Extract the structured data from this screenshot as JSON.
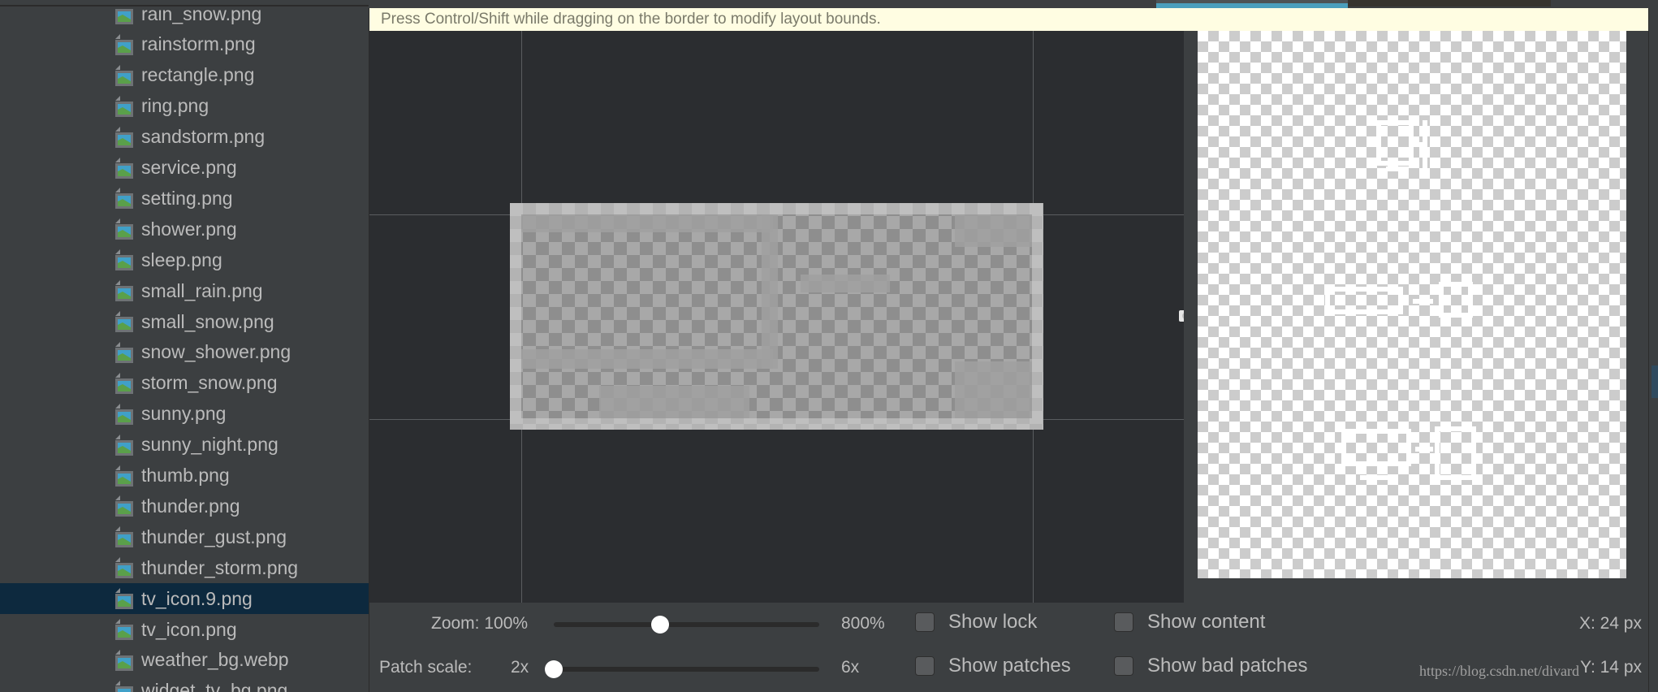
{
  "top_tabs": {
    "active_color": "#4a9fbd"
  },
  "sidebar": {
    "selected_index": 19,
    "items": [
      {
        "label": "rain_snow.png"
      },
      {
        "label": "rainstorm.png"
      },
      {
        "label": "rectangle.png"
      },
      {
        "label": "ring.png"
      },
      {
        "label": "sandstorm.png"
      },
      {
        "label": "service.png"
      },
      {
        "label": "setting.png"
      },
      {
        "label": "shower.png"
      },
      {
        "label": "sleep.png"
      },
      {
        "label": "small_rain.png"
      },
      {
        "label": "small_snow.png"
      },
      {
        "label": "snow_shower.png"
      },
      {
        "label": "storm_snow.png"
      },
      {
        "label": "sunny.png"
      },
      {
        "label": "sunny_night.png"
      },
      {
        "label": "thumb.png"
      },
      {
        "label": "thunder.png"
      },
      {
        "label": "thunder_gust.png"
      },
      {
        "label": "thunder_storm.png"
      },
      {
        "label": "tv_icon.9.png"
      },
      {
        "label": "tv_icon.png"
      },
      {
        "label": "weather_bg.webp"
      },
      {
        "label": "widget_tv_bg.png"
      }
    ],
    "icon": "image-file-icon"
  },
  "editor": {
    "hint": "Press Control/Shift while dragging on the border to modify layout bounds."
  },
  "controls": {
    "zoom_label": "Zoom: 100%",
    "zoom_max": "800%",
    "zoom_value_percent": 100,
    "patch_scale_label": "Patch scale:",
    "patch_scale_min": "2x",
    "patch_scale_max": "6x",
    "patch_scale_value": 2,
    "show_lock": {
      "label": "Show lock",
      "checked": false
    },
    "show_content": {
      "label": "Show content",
      "checked": false
    },
    "show_patches": {
      "label": "Show patches",
      "checked": false
    },
    "show_bad_patches": {
      "label": "Show bad patches",
      "checked": false
    },
    "x_readout": "X: 24 px",
    "y_readout": "Y: 14 px"
  },
  "watermark": "https://blog.csdn.net/divard"
}
